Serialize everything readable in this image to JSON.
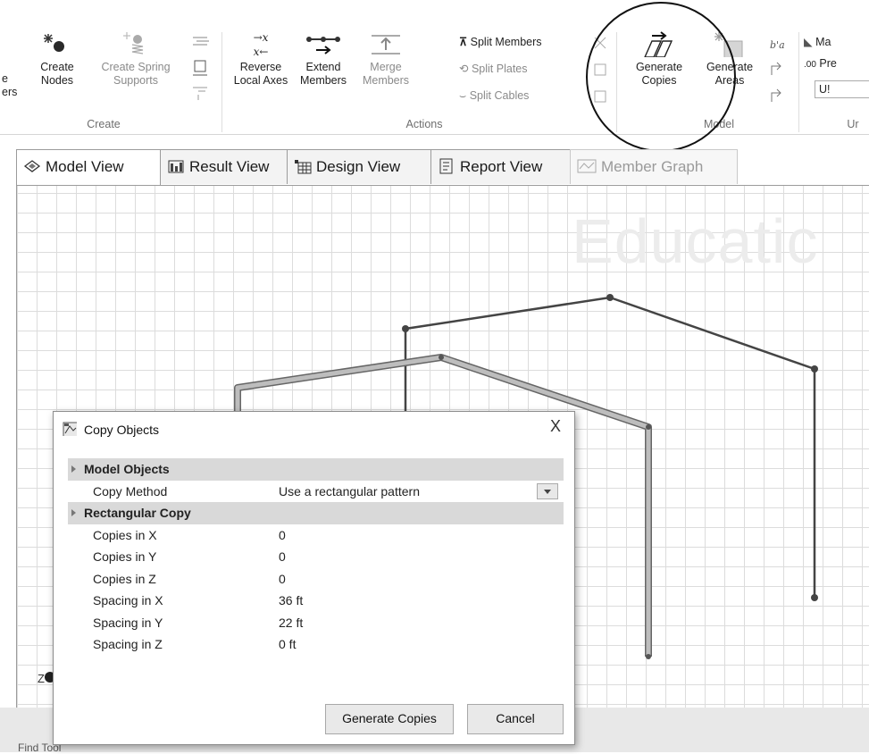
{
  "ribbon": {
    "cut_left_labels": [
      "e",
      "ers"
    ],
    "create_nodes": [
      "Create",
      "Nodes"
    ],
    "create_spring_supports": [
      "Create Spring",
      "Supports"
    ],
    "create_group": "Create",
    "reverse_local_axes": [
      "Reverse",
      "Local Axes"
    ],
    "reverse_glyph_top": "→x",
    "reverse_glyph_bottom": "x←",
    "extend_members": [
      "Extend",
      "Members"
    ],
    "merge_members": [
      "Merge",
      "Members"
    ],
    "split_members": "Split Members",
    "split_plates": "Split Plates",
    "split_cables": "Split Cables",
    "actions_group": "Actions",
    "generate_copies": [
      "Generate",
      "Copies"
    ],
    "generate_areas": [
      "Generate",
      "Areas"
    ],
    "model_group": "Model",
    "right_cut_1": "Ma",
    "right_cut_2": "Pre",
    "right_cut_3": "U!",
    "right_cut_group": "Ur"
  },
  "tabs": [
    {
      "label": "Model View"
    },
    {
      "label": "Result View"
    },
    {
      "label": "Design View"
    },
    {
      "label": "Report View"
    },
    {
      "label": "Member Graph"
    }
  ],
  "canvas": {
    "watermark": "Educatic",
    "axis_label": "Z"
  },
  "status": {
    "find_tool": "Find Tool"
  },
  "dialog": {
    "title": "Copy Objects",
    "close": "X",
    "categories": {
      "model_objects": "Model Objects",
      "rectangular_copy": "Rectangular Copy"
    },
    "copy_method": {
      "name": "Copy Method",
      "value": "Use a rectangular pattern"
    },
    "rows": [
      {
        "name": "Copies in X",
        "value": "0"
      },
      {
        "name": "Copies in Y",
        "value": "0"
      },
      {
        "name": "Copies in Z",
        "value": "0"
      },
      {
        "name": "Spacing in X",
        "value": "36 ft"
      },
      {
        "name": "Spacing in Y",
        "value": "22 ft"
      },
      {
        "name": "Spacing in Z",
        "value": "0 ft"
      }
    ],
    "generate_button": "Generate Copies",
    "cancel_button": "Cancel"
  }
}
